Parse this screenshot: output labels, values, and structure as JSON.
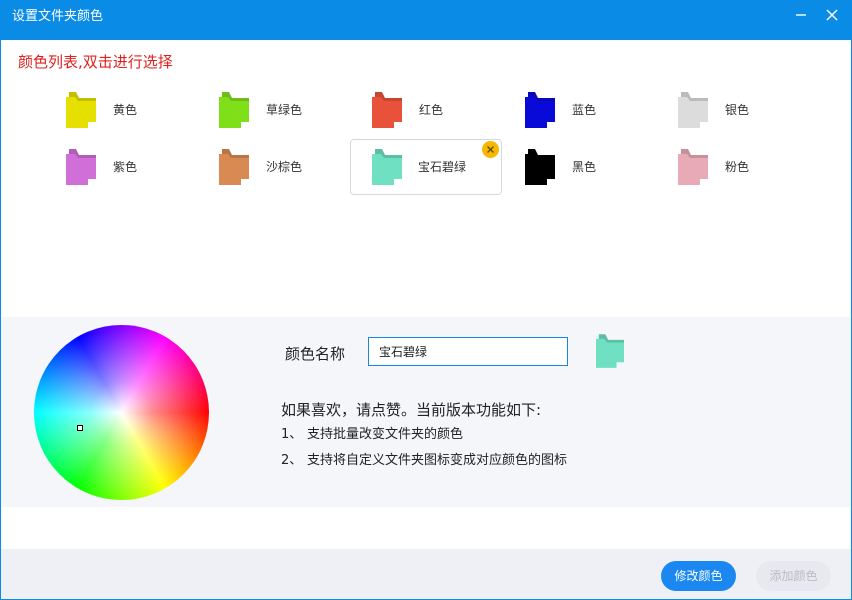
{
  "window": {
    "title": "设置文件夹颜色"
  },
  "color_list": {
    "heading": "颜色列表,双击进行选择",
    "items": [
      {
        "label": "黄色",
        "color": "#e6e000"
      },
      {
        "label": "草绿色",
        "color": "#7fe01a"
      },
      {
        "label": "红色",
        "color": "#e8523b"
      },
      {
        "label": "蓝色",
        "color": "#0a0ad8"
      },
      {
        "label": "银色",
        "color": "#dcdcdc"
      },
      {
        "label": "紫色",
        "color": "#d16fd8"
      },
      {
        "label": "沙棕色",
        "color": "#d98a52"
      },
      {
        "label": "宝石碧绿",
        "color": "#6fe0c2",
        "selected": true
      },
      {
        "label": "黑色",
        "color": "#000000"
      },
      {
        "label": "粉色",
        "color": "#e8aab6"
      }
    ]
  },
  "editor": {
    "name_label": "颜色名称",
    "name_value": "宝石碧绿",
    "preview_color": "#6fe0c2",
    "intro": "如果喜欢，请点赞。当前版本功能如下:",
    "features": [
      {
        "num": "1、",
        "text": "支持批量改变文件夹的颜色"
      },
      {
        "num": "2、",
        "text": "支持将自定义文件夹图标变成对应颜色的图标"
      }
    ]
  },
  "footer": {
    "modify_label": "修改颜色",
    "add_label": "添加颜色"
  }
}
